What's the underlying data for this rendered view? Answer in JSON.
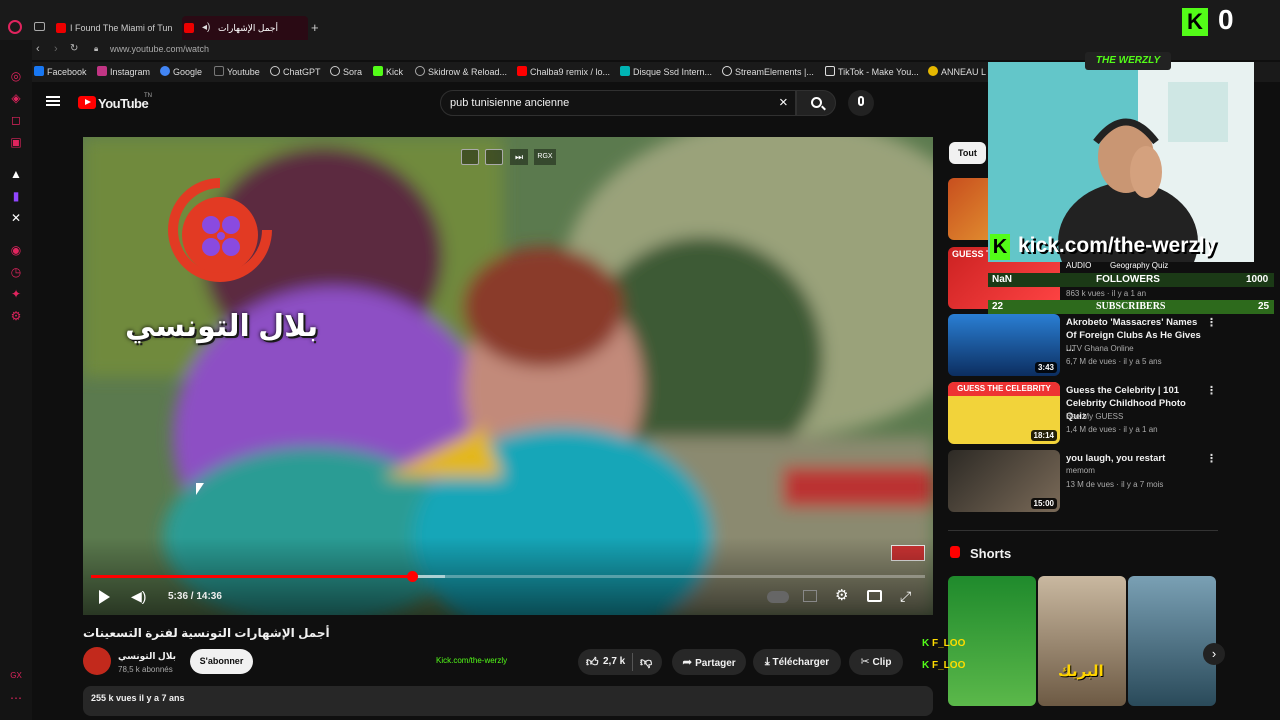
{
  "browser": {
    "tabs": [
      {
        "label": "I Found The Miami of Tun",
        "active": false
      },
      {
        "label": "أجمل الإشهارات التونسية",
        "active": true
      }
    ],
    "new_tab": "+",
    "url": "www.youtube.com/watch",
    "bookmarks": [
      {
        "label": "Facebook",
        "icon": "facebook-icon",
        "color": "#1877f2"
      },
      {
        "label": "Instagram",
        "icon": "instagram-icon",
        "color": "#c13584"
      },
      {
        "label": "Google",
        "icon": "google-icon",
        "color": "#4285f4"
      },
      {
        "label": "Youtube",
        "icon": "page-icon",
        "color": "#777777"
      },
      {
        "label": "ChatGPT",
        "icon": "chatgpt-icon",
        "color": "#cccccc"
      },
      {
        "label": "Sora",
        "icon": "sora-icon",
        "color": "#cccccc"
      },
      {
        "label": "Kick",
        "icon": "kick-icon",
        "color": "#53fc18"
      },
      {
        "label": "Skidrow & Reload...",
        "icon": "skidrow-icon",
        "color": "#aaaaaa"
      },
      {
        "label": "Chalba9 remix / lo...",
        "icon": "youtube-icon",
        "color": "#ff0000"
      },
      {
        "label": "Disque Ssd Intern...",
        "icon": "disk-icon",
        "color": "#00b3b3"
      },
      {
        "label": "StreamElements |...",
        "icon": "streamelements-icon",
        "color": "#dddddd"
      },
      {
        "label": "TikTok - Make You...",
        "icon": "tiktok-icon",
        "color": "#dddddd"
      },
      {
        "label": "ANNEAU L",
        "icon": "ring-icon",
        "color": "#e6b800"
      }
    ]
  },
  "youtube": {
    "logo_text": "YouTube",
    "logo_suffix": "TN",
    "search_value": "pub tunisienne ancienne",
    "player": {
      "watermark_arabic": "بلال التونسي",
      "time": "5:36 / 14:36",
      "progress": 0.385,
      "buffered": 0.425,
      "top_icons": [
        "pip-icon",
        "miniplayer-icon",
        "skip-icon",
        "rgx-icon"
      ],
      "rgx_label": "RGX"
    },
    "video_title": "أجمل الإشهارات التونسية لفترة التسعينات",
    "channel": {
      "name": "بلال التونسي",
      "subscribers": "78,5 k abonnés",
      "subscribe_label": "S'abonner"
    },
    "promo_text": "Kick.com/the-werzly",
    "actions": {
      "likes": "2,7 k",
      "share": "Partager",
      "download": "Télécharger",
      "clip": "Clip"
    },
    "stats": "255 k vues  il y a 7 ans",
    "filter_chip": "Tout",
    "recommendations": [
      {
        "title": "",
        "channel": "",
        "meta": "",
        "duration": ""
      },
      {
        "title": "Geography Quiz",
        "channel": "AUDIO",
        "meta": "863 k vues · il y a 1 an",
        "duration": "",
        "thumb_label": "GUESS T"
      },
      {
        "title": "Akrobeto 'Massacres' Names Of Foreign Clubs As He Gives ...",
        "channel": "UTV Ghana Online",
        "meta": "6,7 M de vues · il y a 5 ans",
        "duration": "3:43"
      },
      {
        "title": "Guess the Celebrity | 101 Celebrity Childhood Photo Quiz",
        "channel": "Bee My GUESS",
        "meta": "1,4 M de vues · il y a 1 an",
        "duration": "18:14",
        "thumb_label": "GUESS THE CELEBRITY"
      },
      {
        "title": "you laugh, you restart",
        "channel": "memom",
        "meta": "13 M de vues · il y a 7 mois",
        "duration": "15:00"
      }
    ],
    "shorts_label": "Shorts",
    "shorts": [
      {
        "overlay": ""
      },
      {
        "overlay": "البريك"
      },
      {
        "overlay": ""
      }
    ]
  },
  "stream_overlay": {
    "banner": "THE WERZLY",
    "kick_url": "kick.com/the-werzly",
    "followers_label": "FOLLOWERS",
    "followers_left": "NaN",
    "followers_goal": "1000",
    "subscribers_label": "SUBSCRIBERS",
    "subscribers_left": "22",
    "subscribers_goal": "25",
    "top_badge": "0",
    "chat_tags": [
      "F_LOO",
      "F_LOO"
    ],
    "colors": {
      "kick_green": "#53fc18",
      "youtube_red": "#ff0000",
      "opera_red": "#e0245e"
    }
  }
}
